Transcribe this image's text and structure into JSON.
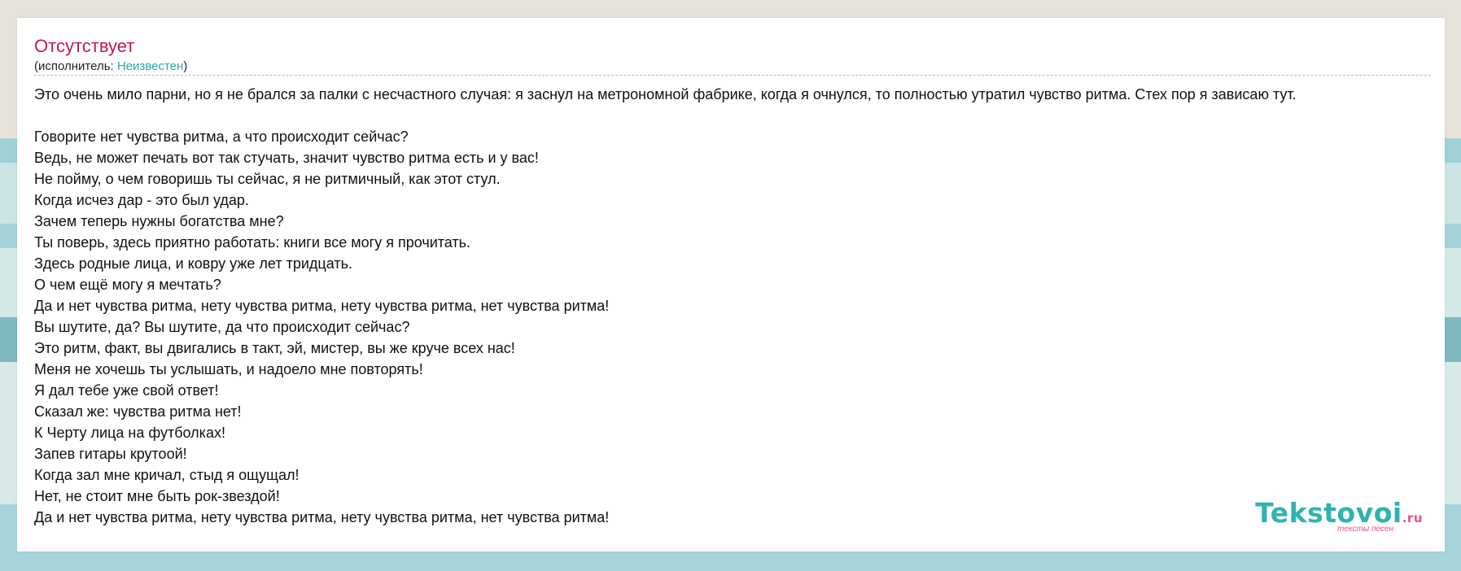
{
  "song": {
    "title": "Отсутствует",
    "artist_prefix": "(исполнитель: ",
    "artist_name": "Неизвестен",
    "artist_suffix": ")"
  },
  "lyrics": {
    "intro": "Это очень мило парни, но я не брался за палки с несчастного случая: я заснул на метрономной фабрике, когда я очнулся, то полностью утратил чувство ритма. Стех пор я зависаю тут.",
    "lines": [
      "Говорите нет чувства ритма, а что происходит сейчас?",
      "Ведь, не может печать вот так стучать, значит чувство ритма есть и у вас!",
      "Не пойму, о чем говоришь ты сейчас, я не ритмичный, как этот стул.",
      "Когда исчез дар - это был удар.",
      "Зачем теперь нужны богатства мне?",
      "Ты поверь, здесь приятно работать: книги все могу я прочитать.",
      "Здесь родные лица, и ковру уже лет тридцать.",
      "О чем ещё могу я мечтать?",
      "Да и нет чувства ритма, нету чувства ритма, нету чувства ритма, нет чувства ритма!",
      "Вы шутите, да? Вы шутите, да что происходит сейчас?",
      "Это ритм, факт, вы двигались в такт, эй, мистер, вы же круче всех нас!",
      "Меня не хочешь ты услышать, и надоело мне повторять!",
      "Я дал тебе уже свой ответ!",
      "Сказал же: чувства ритма нет!",
      "К Черту лица на футболках!",
      "Запев гитары крутоой!",
      "Когда зал мне кричал, стыд я ощущал!",
      "Нет, не стоит мне быть рок-звездой!",
      "Да и нет чувства ритма, нету чувства ритма, нету чувства ритма, нет чувства ритма!"
    ]
  },
  "logo": {
    "main": "Tekstovoi",
    "suffix": ".ru",
    "subtitle": "тексты песен"
  },
  "colors": {
    "title": "#c2185b",
    "link": "#2aa7a7",
    "logo_main": "#2fb3b0",
    "logo_accent": "#e4527a"
  }
}
